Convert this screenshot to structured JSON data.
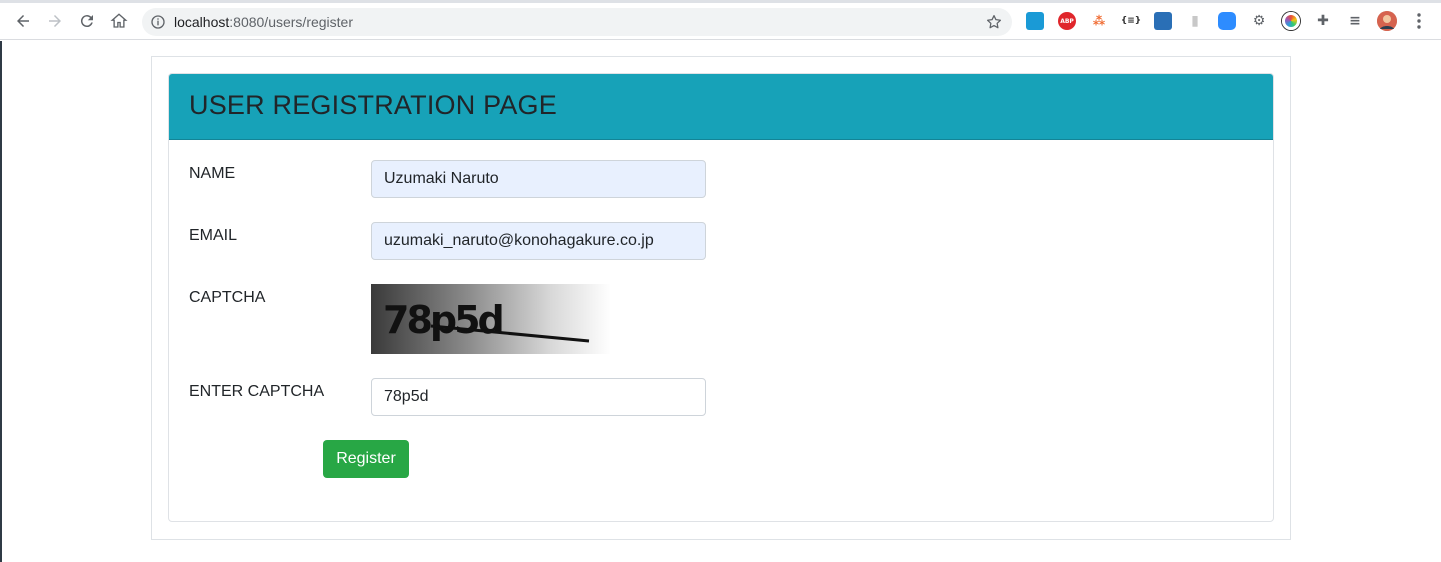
{
  "browser": {
    "url_host": "localhost",
    "url_path": ":8080/users/register",
    "extensions": [
      {
        "name": "screen-capture-icon",
        "label": "",
        "color": "#1a9ad6"
      },
      {
        "name": "adblock-icon",
        "label": "ABP",
        "color": "#e0262b"
      },
      {
        "name": "tree-icon",
        "label": "",
        "color": "#f06a30"
      },
      {
        "name": "json-icon",
        "label": "{≡}",
        "color": "#333333"
      },
      {
        "name": "scribe-icon",
        "label": "",
        "color": "#2a6fb6"
      },
      {
        "name": "bookmarks-icon",
        "label": "",
        "color": "#c8c8c8"
      },
      {
        "name": "zoom-icon",
        "label": "",
        "color": "#2d8cff"
      },
      {
        "name": "gear-ext-icon",
        "label": "",
        "color": "#5f6368"
      },
      {
        "name": "color-picker-icon",
        "label": "",
        "color": "#7b3fd1"
      },
      {
        "name": "puzzle-icon",
        "label": "",
        "color": "#5f6368"
      },
      {
        "name": "reading-list-icon",
        "label": "",
        "color": "#5f6368"
      }
    ]
  },
  "page": {
    "title": "USER REGISTRATION PAGE",
    "name_label": "NAME",
    "name_value": "Uzumaki Naruto",
    "email_label": "EMAIL",
    "email_value": "uzumaki_naruto@konohagakure.co.jp",
    "captcha_label": "CAPTCHA",
    "captcha_text": "78p5d",
    "enter_captcha_label": "ENTER CAPTCHA",
    "enter_captcha_value": "78p5d",
    "register_label": "Register"
  },
  "colors": {
    "header_bg": "#17a2b8",
    "button_bg": "#28a745",
    "autofill_bg": "#e8f0fe"
  }
}
